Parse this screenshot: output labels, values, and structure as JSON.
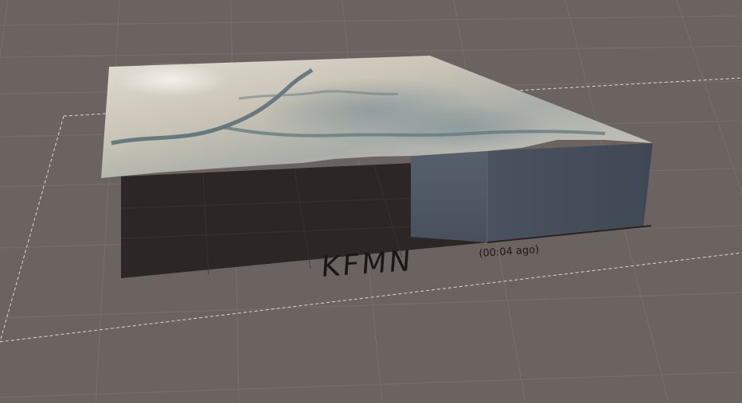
{
  "scene": {
    "station_id": "KFMN",
    "update_age": "(00:04 ago)",
    "colors": {
      "background": "#6b6360",
      "grid_line": "#7a7370",
      "boundary_line": "#d9d6d4",
      "shadow": "#2c2624",
      "block_side": "#4d5560",
      "block_top_edge": "#5e6873",
      "terrain_light": "#d8d3c8",
      "terrain_dark": "#5f6e72",
      "label_text": "#1a1715"
    }
  }
}
